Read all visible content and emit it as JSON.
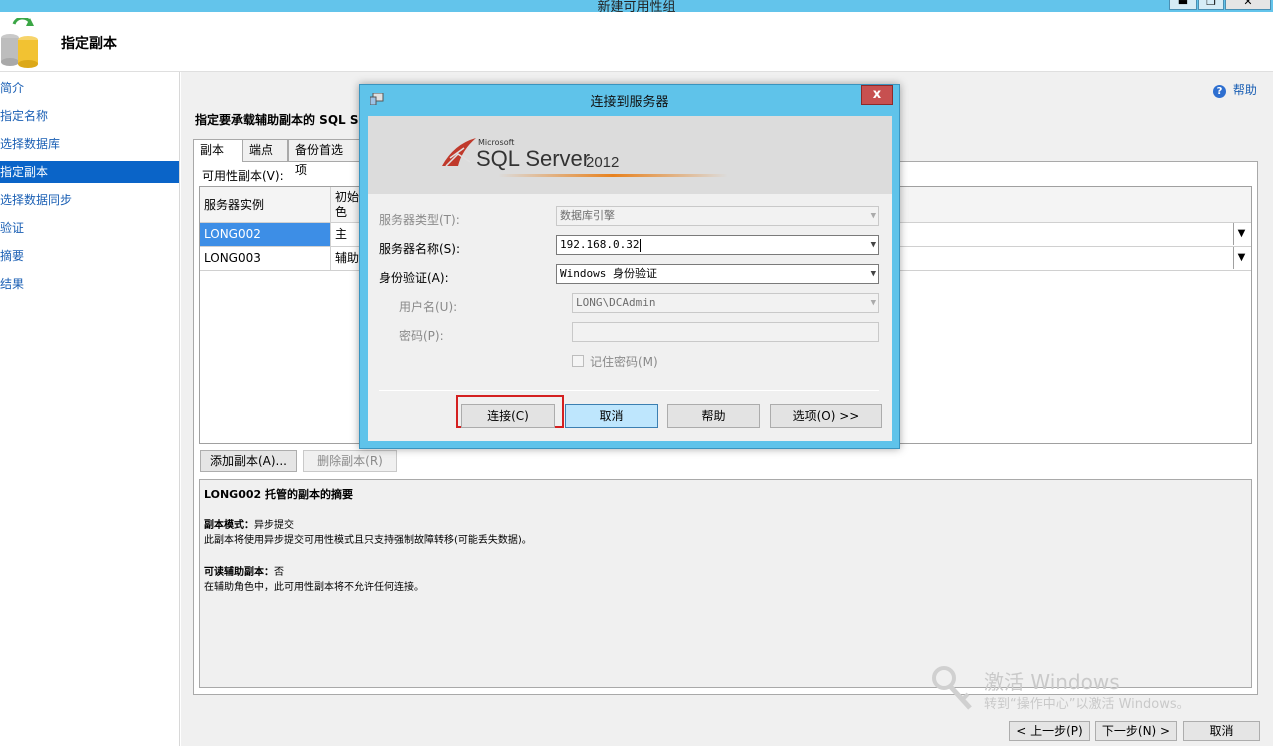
{
  "window": {
    "title": "新建可用性组"
  },
  "header": {
    "title": "指定副本"
  },
  "sidebar": {
    "items": [
      {
        "label": "简介"
      },
      {
        "label": "指定名称"
      },
      {
        "label": "选择数据库"
      },
      {
        "label": "指定副本"
      },
      {
        "label": "选择数据同步"
      },
      {
        "label": "验证"
      },
      {
        "label": "摘要"
      },
      {
        "label": "结果"
      }
    ]
  },
  "main": {
    "help_label": "帮助",
    "instruction": "指定要承载辅助副本的 SQL Se",
    "tabs": [
      {
        "label": "副本"
      },
      {
        "label": "端点"
      },
      {
        "label": "备份首选项"
      }
    ],
    "grid_label": "可用性副本(V):",
    "columns": {
      "server": "服务器实例",
      "role_line1": "初始",
      "role_line2": "色"
    },
    "rows": [
      {
        "server": "LONG002",
        "role": "主"
      },
      {
        "server": "LONG003",
        "role": "辅助"
      }
    ],
    "add_replica": "添加副本(A)...",
    "remove_replica": "删除副本(R)",
    "summary": {
      "title": "LONG002 托管的副本的摘要",
      "mode_label": "副本模式：",
      "mode_value": "异步提交",
      "mode_desc": "此副本将使用异步提交可用性模式且只支持强制故障转移(可能丢失数据)。",
      "readable_label": "可读辅助副本：",
      "readable_value": "否",
      "readable_desc": "在辅助角色中，此可用性副本将不允许任何连接。"
    },
    "footer": {
      "prev": "< 上一步(P)",
      "next": "下一步(N) >",
      "cancel": "取消"
    }
  },
  "dialog": {
    "title": "连接到服务器",
    "close": "x",
    "logo_microsoft": "Microsoft",
    "logo_product": "SQL Server",
    "logo_version": "2012",
    "server_type_label": "服务器类型(T):",
    "server_type_value": "数据库引擎",
    "server_name_label": "服务器名称(S):",
    "server_name_value": "192.168.0.32",
    "auth_label": "身份验证(A):",
    "auth_value": "Windows 身份验证",
    "username_label": "用户名(U):",
    "username_value": "LONG\\DCAdmin",
    "password_label": "密码(P):",
    "password_value": "",
    "remember_label": "记住密码(M)",
    "buttons": {
      "connect": "连接(C)",
      "cancel": "取消",
      "help": "帮助",
      "options": "选项(O) >>"
    }
  },
  "watermark": {
    "line1": "激活 Windows",
    "line2": "转到“操作中心”以激活 Windows。"
  },
  "colors": {
    "accent": "#0a64c8",
    "titlebar": "#63c4eb",
    "dialog_frame": "#5fc3ea",
    "highlight_red": "#d42020"
  }
}
